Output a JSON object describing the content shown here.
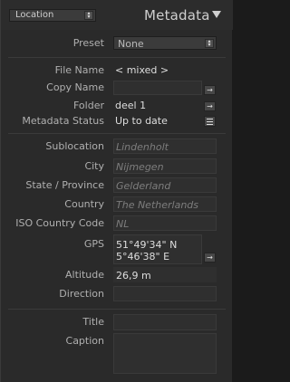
{
  "header": {
    "preset_menu": "Location",
    "title": "Metadata"
  },
  "preset": {
    "label": "Preset",
    "value": "None"
  },
  "file": {
    "file_name": {
      "label": "File Name",
      "value": "< mixed >"
    },
    "copy_name": {
      "label": "Copy Name",
      "value": ""
    },
    "folder": {
      "label": "Folder",
      "value": "deel 1"
    },
    "metadata_status": {
      "label": "Metadata Status",
      "value": "Up to date"
    }
  },
  "location": {
    "sublocation": {
      "label": "Sublocation",
      "value": "Lindenholt"
    },
    "city": {
      "label": "City",
      "value": "Nijmegen"
    },
    "state": {
      "label": "State / Province",
      "value": "Gelderland"
    },
    "country": {
      "label": "Country",
      "value": "The Netherlands"
    },
    "iso": {
      "label": "ISO Country Code",
      "value": "NL"
    },
    "gps": {
      "label": "GPS",
      "line1": "51°49'34\" N",
      "line2": "5°46'38\" E"
    },
    "altitude": {
      "label": "Altitude",
      "value": "26,9 m"
    },
    "direction": {
      "label": "Direction",
      "value": ""
    }
  },
  "content": {
    "title": {
      "label": "Title",
      "value": ""
    },
    "caption": {
      "label": "Caption",
      "value": ""
    }
  }
}
